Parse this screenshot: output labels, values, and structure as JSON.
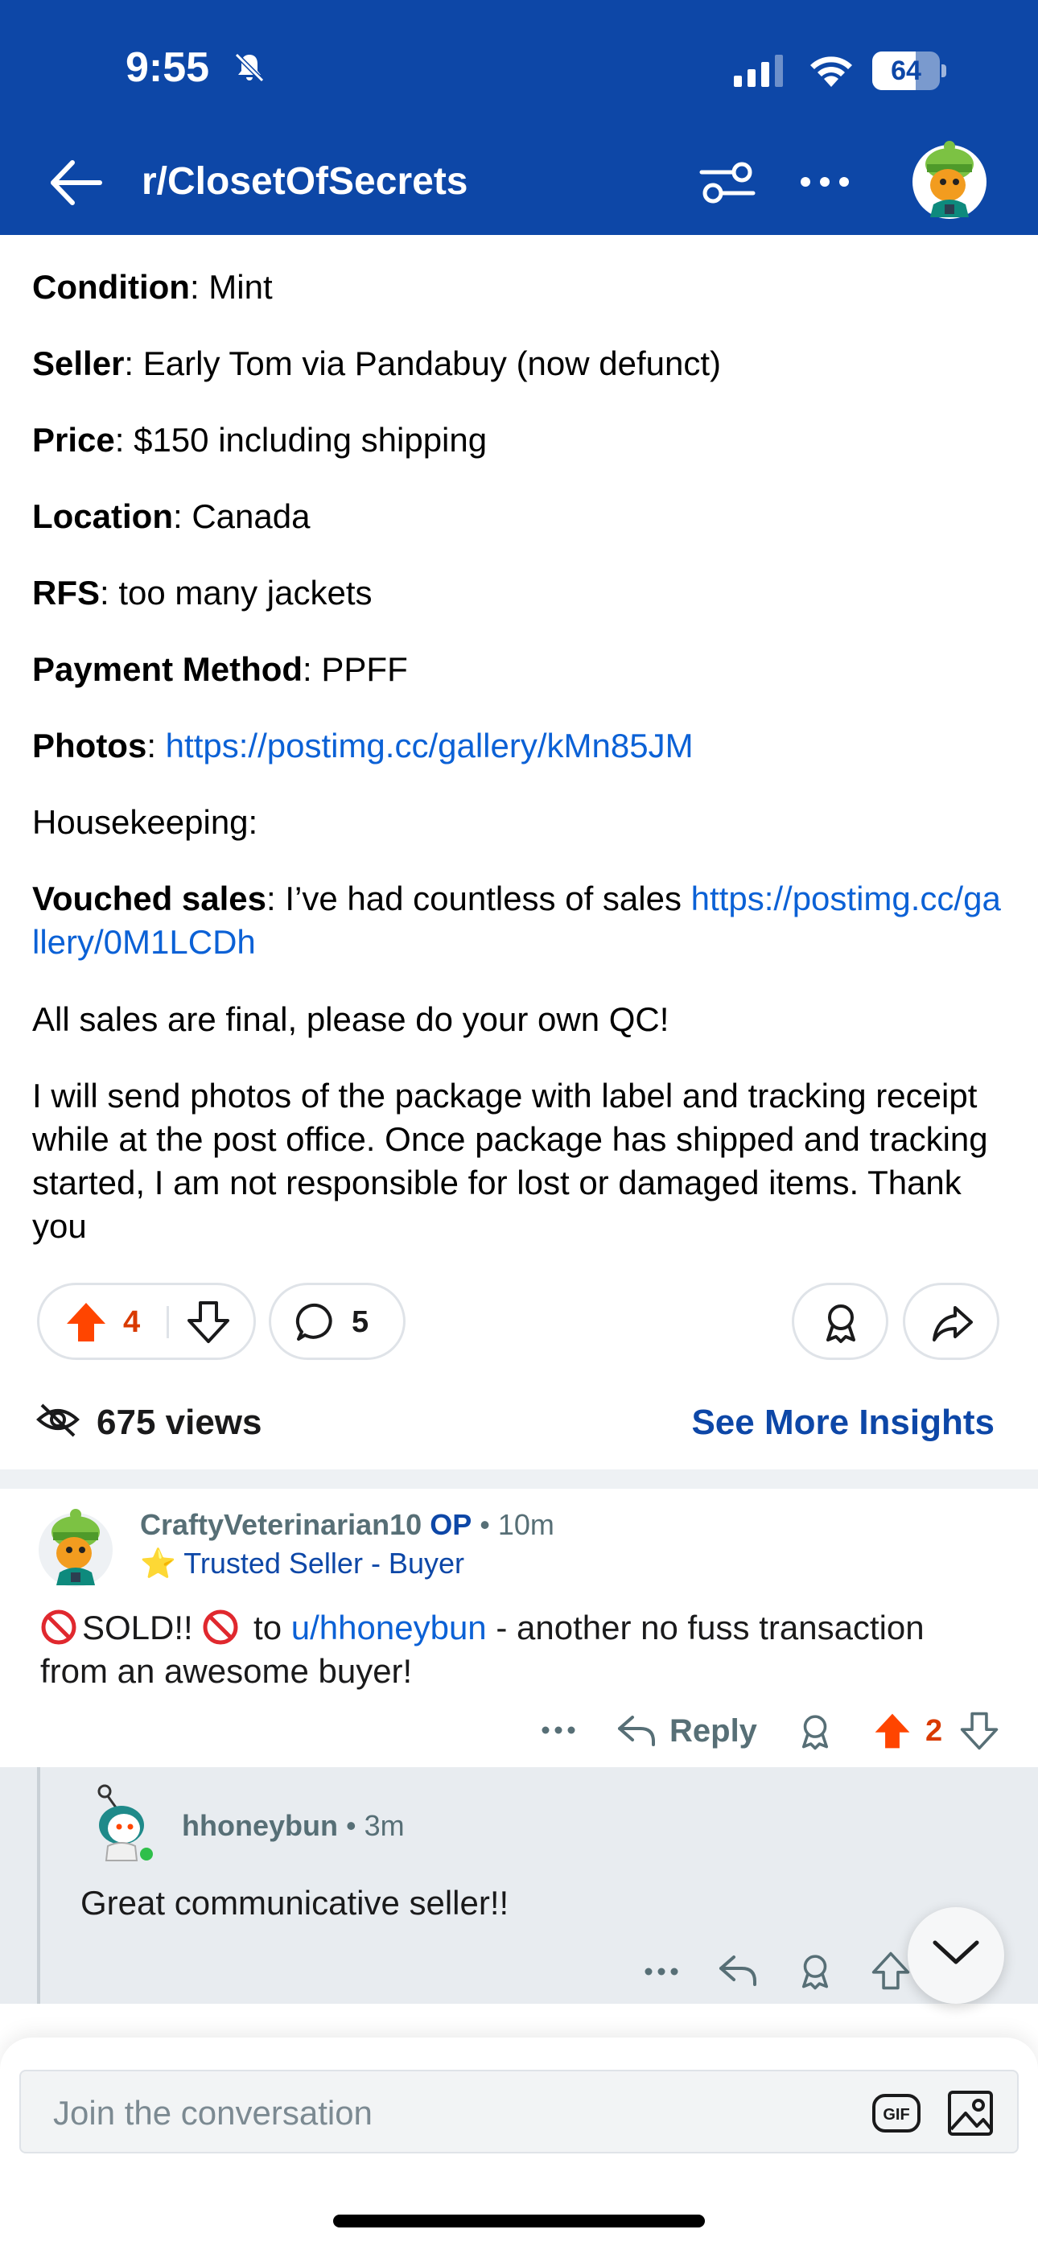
{
  "status_bar": {
    "time": "9:55",
    "battery": "64",
    "battery_level": 0.64,
    "icons": [
      "bell-off-icon",
      "signal-icon",
      "wifi-icon",
      "battery-icon"
    ]
  },
  "header": {
    "subreddit": "r/ClosetOfSecrets",
    "background": "#0d47a7",
    "icons": [
      "back-arrow-icon",
      "filter-icon",
      "more-icon",
      "avatar"
    ]
  },
  "post": {
    "condition_label": "Condition",
    "condition_value": ": Mint",
    "seller_label": "Seller",
    "seller_value": ": Early Tom via Pandabuy (now defunct)",
    "price_label": "Price",
    "price_value": ": $150 including shipping",
    "location_label": "Location",
    "location_value": ": Canada",
    "rfs_label": "RFS",
    "rfs_value": ": too many jackets",
    "payment_label": "Payment Method",
    "payment_value": ": PPFF",
    "photos_label": "Photos",
    "photos_sep": ": ",
    "photos_link": "https://postimg.cc/gallery/kMn85JM",
    "housekeeping": "Housekeeping:",
    "vouched_label": "Vouched sales",
    "vouched_value": ": I’ve had countless of sales ",
    "vouched_link": "https://postimg.cc/gallery/0M1LCDh",
    "final_text": "All sales are final, please do your own QC!",
    "shipping_text": "I will send photos of the package with label and tracking receipt while at the post office. Once package has shipped and tracking started, I am not responsible for lost or damaged items. Thank you"
  },
  "actions": {
    "upvotes": "4",
    "comments": "5",
    "upvote_color": "#ff4500"
  },
  "views": {
    "count_text": "675 views",
    "insights_label": "See More Insights"
  },
  "comments": [
    {
      "username": "CraftyVeterinarian10",
      "op_badge": "OP",
      "time": "10m",
      "flair": "Trusted Seller - Buyer",
      "text_sold": "SOLD!!",
      "text_to": " to ",
      "mention": "u/hhoneybun",
      "text_rest": " - another no fuss transaction from an awesome buyer!",
      "reply_label": "Reply",
      "score": "2"
    },
    {
      "username": "hhoneybun",
      "time": "3m",
      "text": "Great communicative seller!!"
    }
  ],
  "composer": {
    "placeholder": "Join the conversation",
    "gif_label": "GIF"
  }
}
